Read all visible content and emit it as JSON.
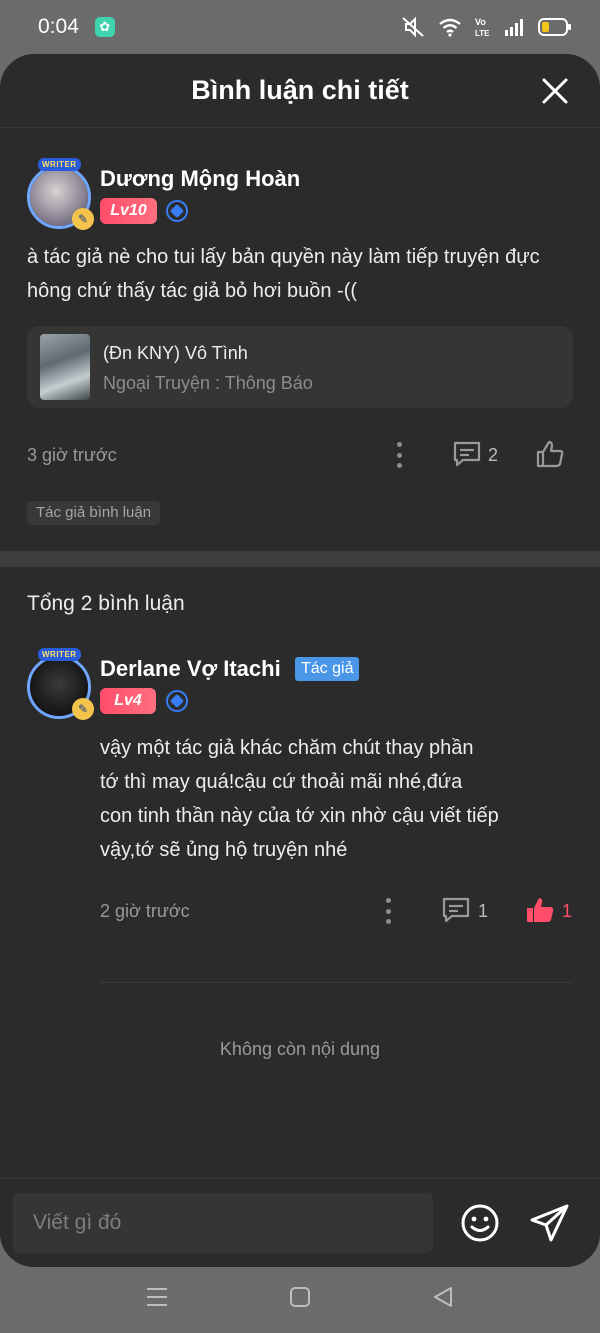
{
  "status_bar": {
    "time": "0:04",
    "icons": [
      "app-notification-icon",
      "mute-icon",
      "wifi-icon",
      "volte-icon",
      "signal-icon",
      "battery-icon"
    ],
    "volte_text": "Vo\nLTE"
  },
  "header": {
    "title": "Bình luận chi tiết",
    "close_icon": "close-icon"
  },
  "main_comment": {
    "avatar_tag": "WRITER",
    "username": "Dương Mộng Hoàn",
    "level": "Lv10",
    "text": "à tác giả nè cho tui lấy bản quyền này làm tiếp truyện đực hông chứ thấy tác giả bỏ hơi buồn -((",
    "story": {
      "title": "(Đn KNY) Vô Tình",
      "chapter": "Ngoại Truyện : Thông Báo"
    },
    "time": "3 giờ trước",
    "reply_count": "2",
    "author_comment_tag": "Tác giả bình luận"
  },
  "replies_section": {
    "total_label": "Tổng 2 bình luận",
    "replies": [
      {
        "avatar_tag": "WRITER",
        "username": "Derlane Vợ Itachi",
        "author_tag": "Tác giả",
        "level": "Lv4",
        "text_lines": [
          "vậy một tác giả khác chăm chút thay phần",
          "tớ thì may quá!cậu cứ thoải mãi nhé,đứa",
          "con tinh thần này của tớ xin nhờ cậu viết tiếp",
          "vậy,tớ sẽ ủng hộ truyện nhé"
        ],
        "time": "2 giờ trước",
        "reply_count": "1",
        "like_count": "1",
        "liked": true
      }
    ],
    "end_note": "Không còn nội dung"
  },
  "input_bar": {
    "placeholder": "Viết gì đó",
    "emoji_icon": "emoji-icon",
    "send_icon": "send-icon"
  },
  "colors": {
    "sheet_bg": "#2b2b2b",
    "level_badge": "#ff4d6a",
    "author_tag": "#4a97e8",
    "like_active": "#ff4d6a",
    "verify": "#3a7cf5"
  },
  "nav_bar": {
    "icons": [
      "menu-icon",
      "home-square-icon",
      "back-triangle-icon"
    ]
  }
}
